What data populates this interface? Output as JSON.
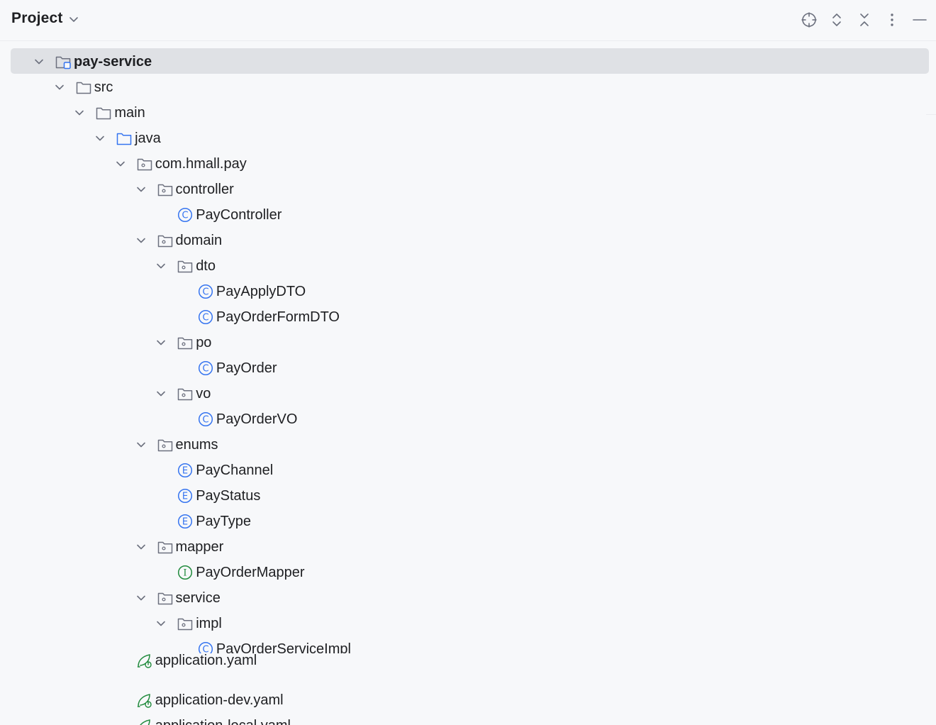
{
  "header": {
    "title": "Project",
    "icons": [
      "locate-icon",
      "expand-all-icon",
      "collapse-all-icon",
      "more-options-icon",
      "hide-icon"
    ]
  },
  "colors": {
    "background": "#f7f8fa",
    "selection": "#dfe1e5",
    "class_icon": "#3574f0",
    "interface_icon": "#208a3c",
    "yaml_icon": "#208a3c",
    "folder_icon": "#6c707e",
    "source_folder_icon": "#3574f0"
  },
  "tree": [
    {
      "label": "pay-service",
      "type": "module",
      "depth": 0,
      "expanded": true,
      "selected": true
    },
    {
      "label": "src",
      "type": "folder",
      "depth": 1,
      "expanded": true
    },
    {
      "label": "main",
      "type": "folder",
      "depth": 2,
      "expanded": true
    },
    {
      "label": "java",
      "type": "source-folder",
      "depth": 3,
      "expanded": true
    },
    {
      "label": "com.hmall.pay",
      "type": "package",
      "depth": 4,
      "expanded": true
    },
    {
      "label": "controller",
      "type": "package",
      "depth": 5,
      "expanded": true
    },
    {
      "label": "PayController",
      "type": "class",
      "depth": 6
    },
    {
      "label": "domain",
      "type": "package",
      "depth": 5,
      "expanded": true
    },
    {
      "label": "dto",
      "type": "package",
      "depth": 6,
      "expanded": true
    },
    {
      "label": "PayApplyDTO",
      "type": "class",
      "depth": 7
    },
    {
      "label": "PayOrderFormDTO",
      "type": "class",
      "depth": 7
    },
    {
      "label": "po",
      "type": "package",
      "depth": 6,
      "expanded": true
    },
    {
      "label": "PayOrder",
      "type": "class",
      "depth": 7
    },
    {
      "label": "vo",
      "type": "package",
      "depth": 6,
      "expanded": true
    },
    {
      "label": "PayOrderVO",
      "type": "class",
      "depth": 7
    },
    {
      "label": "enums",
      "type": "package",
      "depth": 5,
      "expanded": true
    },
    {
      "label": "PayChannel",
      "type": "enum",
      "depth": 6
    },
    {
      "label": "PayStatus",
      "type": "enum",
      "depth": 6
    },
    {
      "label": "PayType",
      "type": "enum",
      "depth": 6
    },
    {
      "label": "mapper",
      "type": "package",
      "depth": 5,
      "expanded": true
    },
    {
      "label": "PayOrderMapper",
      "type": "interface",
      "depth": 6
    },
    {
      "label": "service",
      "type": "package",
      "depth": 5,
      "expanded": true
    },
    {
      "label": "impl",
      "type": "package",
      "depth": 6,
      "expanded": true
    },
    {
      "label": "PayOrderServiceImpl",
      "type": "class",
      "depth": 7,
      "clipped": true
    },
    {
      "label": "application.yaml",
      "type": "yaml",
      "depth": 4,
      "overlap": true
    },
    {
      "label": "application-dev.yaml",
      "type": "yaml",
      "depth": 4
    },
    {
      "label": "application-local.yaml",
      "type": "yaml",
      "depth": 4
    }
  ]
}
